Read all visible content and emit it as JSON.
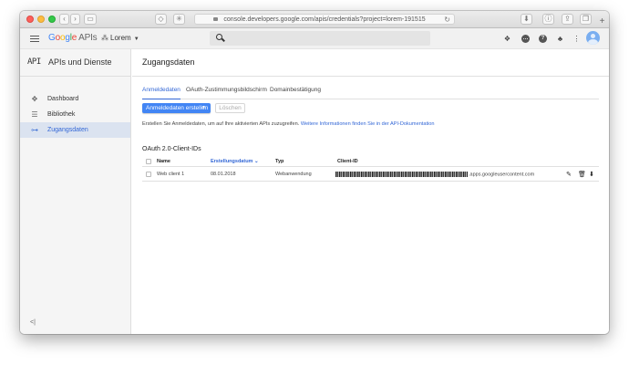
{
  "browser": {
    "url": "console.developers.google.com/apis/credentials?project=lorem-191515",
    "back_icon": "chevron-left-icon",
    "forward_icon": "chevron-right-icon",
    "plus": "+"
  },
  "header": {
    "logo_letters": [
      "G",
      "o",
      "o",
      "g",
      "l",
      "e"
    ],
    "logo_suffix": "APIs",
    "project": "Lorem",
    "icons": [
      "gift-icon",
      "chat-icon",
      "help-icon",
      "bell-icon",
      "more-vert-icon"
    ]
  },
  "sidebar": {
    "glyph": "API",
    "title": "APIs und Dienste",
    "items": [
      {
        "label": "Dashboard",
        "icon": "diamond-icon",
        "glyph": "✥",
        "active": false
      },
      {
        "label": "Bibliothek",
        "icon": "library-icon",
        "glyph": "☰",
        "active": false
      },
      {
        "label": "Zugangsdaten",
        "icon": "key-icon",
        "glyph": "⊶",
        "active": true
      }
    ],
    "collapse": "<|"
  },
  "main": {
    "title": "Zugangsdaten",
    "tabs": [
      "Anmeldedaten",
      "OAuth-Zustimmungsbildschirm",
      "Domainbestätigung"
    ],
    "create_button": "Anmeldedaten erstellen",
    "delete_button": "Löschen",
    "info_text": "Erstellen Sie Anmeldedaten, um auf Ihre aktivierten APIs zuzugreifen.",
    "info_link": "Weitere Informationen finden Sie in der API-Dokumentation",
    "section_title": "OAuth 2.0-Client-IDs",
    "columns": [
      "Name",
      "Erstellungsdatum",
      "Typ",
      "Client-ID"
    ],
    "rows": [
      {
        "name": "Web client 1",
        "date": "08.01.2018",
        "type": "Webanwendung",
        "client_id_suffix": ".apps.googleusercontent.com"
      }
    ]
  },
  "colors": {
    "accent": "#4285f4",
    "link": "#3367d6",
    "sidebar_active": "#dbe3f0"
  }
}
